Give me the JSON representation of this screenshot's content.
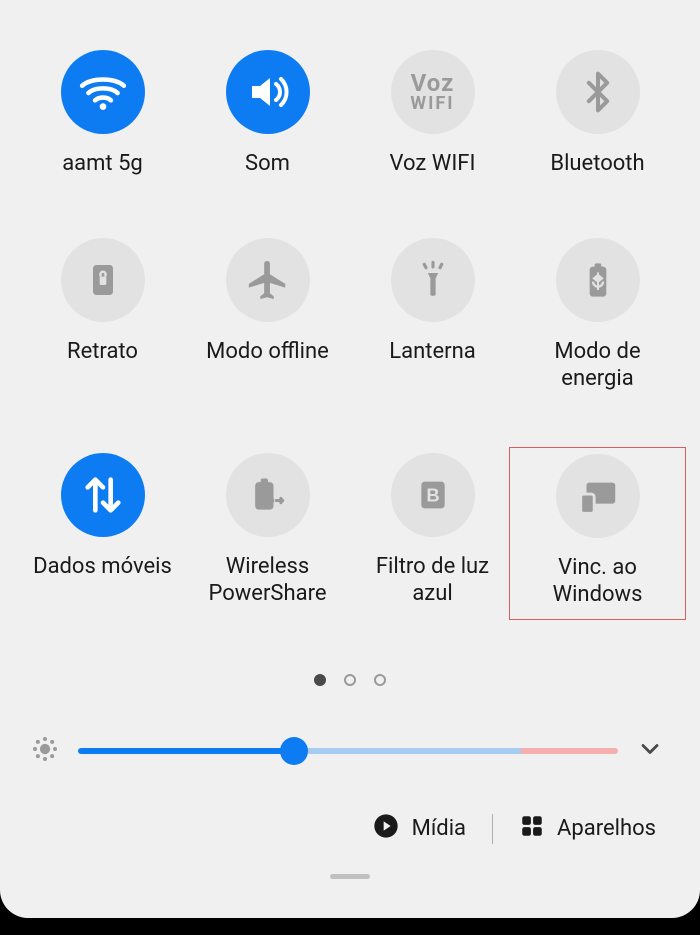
{
  "colors": {
    "accent": "#0d7cf2",
    "inactive_tile": "#e2e2e2",
    "icon_inactive": "#9a9a9a",
    "panel_bg": "#f0f0f0",
    "highlight_border": "#d46060"
  },
  "tiles": [
    {
      "id": "wifi",
      "label": "aamt 5g",
      "active": true,
      "icon": "wifi-icon"
    },
    {
      "id": "sound",
      "label": "Som",
      "active": true,
      "icon": "sound-icon"
    },
    {
      "id": "vozwifi",
      "label": "Voz WIFI",
      "active": false,
      "icon": "voz-wifi-icon"
    },
    {
      "id": "bluetooth",
      "label": "Bluetooth",
      "active": false,
      "icon": "bluetooth-icon"
    },
    {
      "id": "rotation",
      "label": "Retrato",
      "active": false,
      "icon": "rotation-lock-icon"
    },
    {
      "id": "airplane",
      "label": "Modo offline",
      "active": false,
      "icon": "airplane-icon"
    },
    {
      "id": "flashlight",
      "label": "Lanterna",
      "active": false,
      "icon": "flashlight-icon"
    },
    {
      "id": "powermode",
      "label": "Modo de energia",
      "active": false,
      "icon": "battery-saver-icon"
    },
    {
      "id": "mobiledata",
      "label": "Dados móveis",
      "active": true,
      "icon": "mobile-data-icon"
    },
    {
      "id": "powershare",
      "label": "Wireless PowerShare",
      "active": false,
      "icon": "power-share-icon"
    },
    {
      "id": "bluelight",
      "label": "Filtro de luz azul",
      "active": false,
      "icon": "blue-light-icon"
    },
    {
      "id": "linktowindows",
      "label": "Vinc. ao Windows",
      "active": false,
      "icon": "link-to-windows-icon",
      "highlighted": true
    }
  ],
  "voz_wifi_text": {
    "line1": "Voz",
    "line2": "WIFI"
  },
  "pagination": {
    "current": 0,
    "total": 3
  },
  "brightness": {
    "value_percent": 40,
    "blue_end_percent": 82
  },
  "bottom": {
    "media_label": "Mídia",
    "devices_label": "Aparelhos"
  }
}
